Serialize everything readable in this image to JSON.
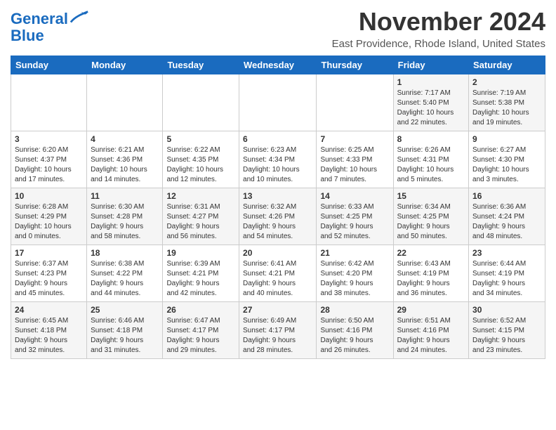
{
  "logo": {
    "line1": "General",
    "line2": "Blue"
  },
  "title": "November 2024",
  "subtitle": "East Providence, Rhode Island, United States",
  "days_of_week": [
    "Sunday",
    "Monday",
    "Tuesday",
    "Wednesday",
    "Thursday",
    "Friday",
    "Saturday"
  ],
  "weeks": [
    [
      {
        "day": "",
        "info": ""
      },
      {
        "day": "",
        "info": ""
      },
      {
        "day": "",
        "info": ""
      },
      {
        "day": "",
        "info": ""
      },
      {
        "day": "",
        "info": ""
      },
      {
        "day": "1",
        "info": "Sunrise: 7:17 AM\nSunset: 5:40 PM\nDaylight: 10 hours\nand 22 minutes."
      },
      {
        "day": "2",
        "info": "Sunrise: 7:19 AM\nSunset: 5:38 PM\nDaylight: 10 hours\nand 19 minutes."
      }
    ],
    [
      {
        "day": "3",
        "info": "Sunrise: 6:20 AM\nSunset: 4:37 PM\nDaylight: 10 hours\nand 17 minutes."
      },
      {
        "day": "4",
        "info": "Sunrise: 6:21 AM\nSunset: 4:36 PM\nDaylight: 10 hours\nand 14 minutes."
      },
      {
        "day": "5",
        "info": "Sunrise: 6:22 AM\nSunset: 4:35 PM\nDaylight: 10 hours\nand 12 minutes."
      },
      {
        "day": "6",
        "info": "Sunrise: 6:23 AM\nSunset: 4:34 PM\nDaylight: 10 hours\nand 10 minutes."
      },
      {
        "day": "7",
        "info": "Sunrise: 6:25 AM\nSunset: 4:33 PM\nDaylight: 10 hours\nand 7 minutes."
      },
      {
        "day": "8",
        "info": "Sunrise: 6:26 AM\nSunset: 4:31 PM\nDaylight: 10 hours\nand 5 minutes."
      },
      {
        "day": "9",
        "info": "Sunrise: 6:27 AM\nSunset: 4:30 PM\nDaylight: 10 hours\nand 3 minutes."
      }
    ],
    [
      {
        "day": "10",
        "info": "Sunrise: 6:28 AM\nSunset: 4:29 PM\nDaylight: 10 hours\nand 0 minutes."
      },
      {
        "day": "11",
        "info": "Sunrise: 6:30 AM\nSunset: 4:28 PM\nDaylight: 9 hours\nand 58 minutes."
      },
      {
        "day": "12",
        "info": "Sunrise: 6:31 AM\nSunset: 4:27 PM\nDaylight: 9 hours\nand 56 minutes."
      },
      {
        "day": "13",
        "info": "Sunrise: 6:32 AM\nSunset: 4:26 PM\nDaylight: 9 hours\nand 54 minutes."
      },
      {
        "day": "14",
        "info": "Sunrise: 6:33 AM\nSunset: 4:25 PM\nDaylight: 9 hours\nand 52 minutes."
      },
      {
        "day": "15",
        "info": "Sunrise: 6:34 AM\nSunset: 4:25 PM\nDaylight: 9 hours\nand 50 minutes."
      },
      {
        "day": "16",
        "info": "Sunrise: 6:36 AM\nSunset: 4:24 PM\nDaylight: 9 hours\nand 48 minutes."
      }
    ],
    [
      {
        "day": "17",
        "info": "Sunrise: 6:37 AM\nSunset: 4:23 PM\nDaylight: 9 hours\nand 45 minutes."
      },
      {
        "day": "18",
        "info": "Sunrise: 6:38 AM\nSunset: 4:22 PM\nDaylight: 9 hours\nand 44 minutes."
      },
      {
        "day": "19",
        "info": "Sunrise: 6:39 AM\nSunset: 4:21 PM\nDaylight: 9 hours\nand 42 minutes."
      },
      {
        "day": "20",
        "info": "Sunrise: 6:41 AM\nSunset: 4:21 PM\nDaylight: 9 hours\nand 40 minutes."
      },
      {
        "day": "21",
        "info": "Sunrise: 6:42 AM\nSunset: 4:20 PM\nDaylight: 9 hours\nand 38 minutes."
      },
      {
        "day": "22",
        "info": "Sunrise: 6:43 AM\nSunset: 4:19 PM\nDaylight: 9 hours\nand 36 minutes."
      },
      {
        "day": "23",
        "info": "Sunrise: 6:44 AM\nSunset: 4:19 PM\nDaylight: 9 hours\nand 34 minutes."
      }
    ],
    [
      {
        "day": "24",
        "info": "Sunrise: 6:45 AM\nSunset: 4:18 PM\nDaylight: 9 hours\nand 32 minutes."
      },
      {
        "day": "25",
        "info": "Sunrise: 6:46 AM\nSunset: 4:18 PM\nDaylight: 9 hours\nand 31 minutes."
      },
      {
        "day": "26",
        "info": "Sunrise: 6:47 AM\nSunset: 4:17 PM\nDaylight: 9 hours\nand 29 minutes."
      },
      {
        "day": "27",
        "info": "Sunrise: 6:49 AM\nSunset: 4:17 PM\nDaylight: 9 hours\nand 28 minutes."
      },
      {
        "day": "28",
        "info": "Sunrise: 6:50 AM\nSunset: 4:16 PM\nDaylight: 9 hours\nand 26 minutes."
      },
      {
        "day": "29",
        "info": "Sunrise: 6:51 AM\nSunset: 4:16 PM\nDaylight: 9 hours\nand 24 minutes."
      },
      {
        "day": "30",
        "info": "Sunrise: 6:52 AM\nSunset: 4:15 PM\nDaylight: 9 hours\nand 23 minutes."
      }
    ]
  ]
}
